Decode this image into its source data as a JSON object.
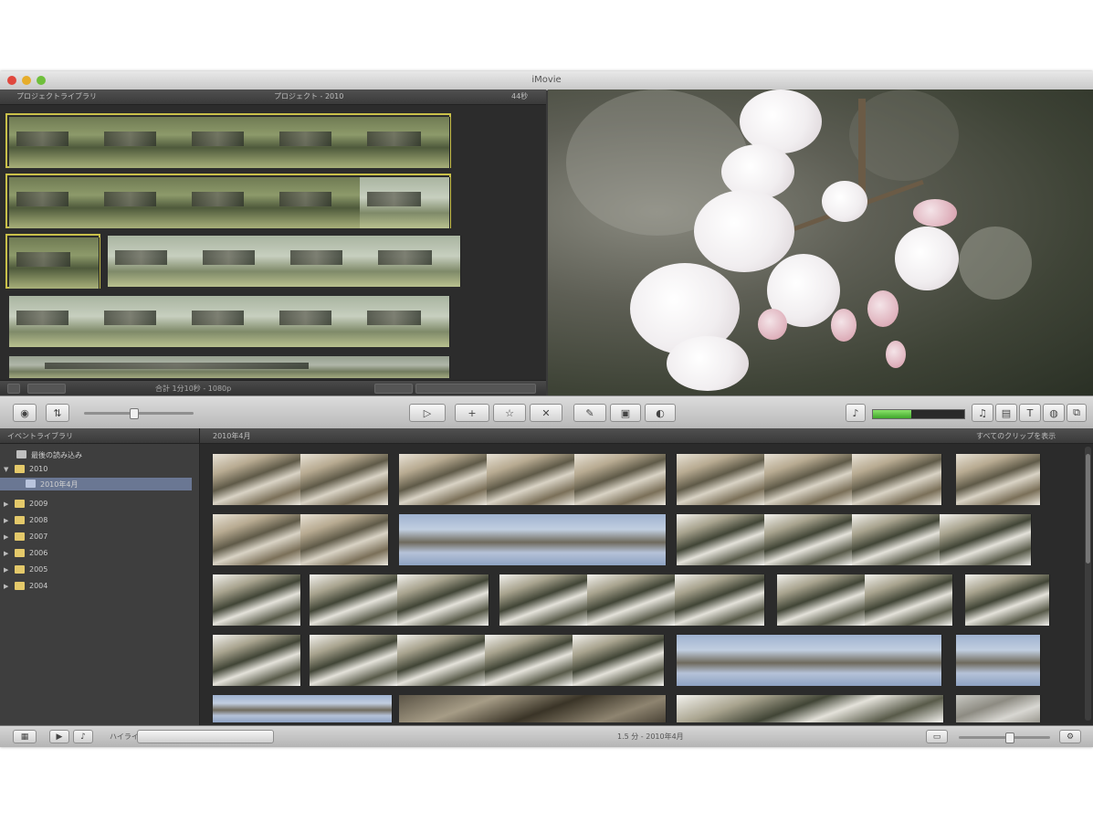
{
  "window": {
    "title": "iMovie"
  },
  "project": {
    "header_left": "プロジェクトライブラリ",
    "header_center": "プロジェクト - 2010",
    "header_right": "44秒",
    "footer_text": "合計 1分10秒 - 1080p"
  },
  "toolbar": {
    "audio_meter_level": 0.42,
    "zoom_level": 0.55
  },
  "library": {
    "header": "イベントライブラリ",
    "items": [
      {
        "label": "最後の読み込み"
      },
      {
        "label": "2010"
      },
      {
        "label": "2010年4月"
      },
      {
        "label": "2009"
      },
      {
        "label": "2008"
      },
      {
        "label": "2007"
      },
      {
        "label": "2006"
      },
      {
        "label": "2005"
      },
      {
        "label": "2004"
      }
    ]
  },
  "events": {
    "header_left": "2010年4月",
    "header_right": "すべてのクリップを表示"
  },
  "status": {
    "center_text": "1.5 分 - 2010年4月",
    "left_text": "ハイライト"
  },
  "colors": {
    "selection": "#c9c04a",
    "library_selected": "#6a7793",
    "meter": "#5fd13f"
  }
}
